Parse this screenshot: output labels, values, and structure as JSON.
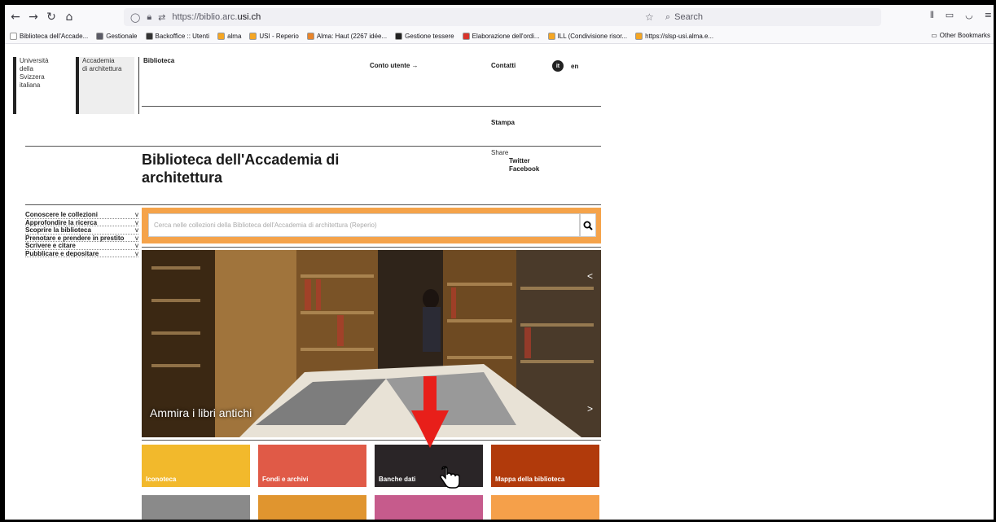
{
  "browser": {
    "url_host_prefix": "https://biblio.arc.",
    "url_host_main": "usi.ch",
    "search_placeholder": "Search",
    "bookmarks": [
      {
        "label": "Biblioteca dell'Accade...",
        "color": "#ffffff"
      },
      {
        "label": "Gestionale",
        "color": "#5b5b66"
      },
      {
        "label": "Backoffice :: Utenti",
        "color": "#333333"
      },
      {
        "label": "alma",
        "color": "#f5a623"
      },
      {
        "label": "USI - Reperio",
        "color": "#f5a623"
      },
      {
        "label": "Alma: Haut (2267 idée...",
        "color": "#e8842a"
      },
      {
        "label": "Gestione tessere",
        "color": "#222222"
      },
      {
        "label": "Elaborazione dell'ordi...",
        "color": "#d9342b"
      },
      {
        "label": "ILL (Condivisione risor...",
        "color": "#f5a623"
      },
      {
        "label": "https://slsp-usi.alma.e...",
        "color": "#f5a623"
      }
    ],
    "other_bookmarks": "Other Bookmarks"
  },
  "header": {
    "university": "Università della Svizzera italiana",
    "academy": "Accademia di architettura",
    "biblioteca": "Biblioteca",
    "account": "Conto utente →",
    "contacts": "Contatti",
    "lang_it": "it",
    "lang_en": "en",
    "stampa": "Stampa"
  },
  "page_title": "Biblioteca dell'Accademia di architettura",
  "share": {
    "label": "Share",
    "twitter": "Twitter",
    "facebook": "Facebook"
  },
  "sidemenu": [
    "Conoscere le collezioni",
    "Approfondire la ricerca",
    "Scoprire la biblioteca",
    "Prenotare e prendere in prestito",
    "Scrivere e citare",
    "Pubblicare e depositare"
  ],
  "search": {
    "placeholder": "Cerca nelle collezioni della Biblioteca dell'Accademia di architettura (Reperio)"
  },
  "hero": {
    "caption": "Ammira i libri antichi",
    "prev": "<",
    "next": ">"
  },
  "tiles": [
    {
      "label": "Iconoteca",
      "color": "#f2b92c"
    },
    {
      "label": "Fondi e archivi",
      "color": "#e05a47"
    },
    {
      "label": "Banche dati",
      "color": "#2a2527"
    },
    {
      "label": "Mappa della biblioteca",
      "color": "#b13a0b"
    }
  ],
  "tiles_row2": [
    {
      "label": "",
      "color": "#8a8a8a"
    },
    {
      "label": "",
      "color": "#e0952f"
    },
    {
      "label": "",
      "color": "#c65b8c"
    },
    {
      "label": "",
      "color": "#f5a04a"
    }
  ],
  "annotation": {
    "arrow_color": "#e81f1a"
  }
}
